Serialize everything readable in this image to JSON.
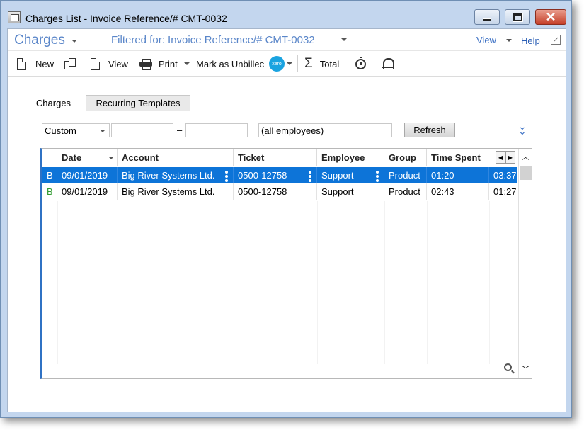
{
  "window": {
    "title": "Charges List - Invoice Reference/# CMT-0032",
    "close_glyph": "✕"
  },
  "header": {
    "module_title": "Charges",
    "filter_text": "Filtered for: Invoice Reference/# CMT-0032",
    "view_label": "View",
    "help_label": "Help"
  },
  "toolbar": {
    "new_label": "New",
    "view_label": "View",
    "print_label": "Print",
    "mark_unbilled_label": "Mark as Unbillec",
    "xero_label": "xero",
    "total_label": "Total"
  },
  "tabs": [
    {
      "label": "Charges",
      "active": true
    },
    {
      "label": "Recurring Templates",
      "active": false
    }
  ],
  "filters": {
    "range_value": "Custom",
    "date_from": "",
    "date_separator": "–",
    "date_to": "",
    "employee_value": "(all employees)",
    "refresh_label": "Refresh"
  },
  "grid": {
    "columns": [
      "Date",
      "Account",
      "Ticket",
      "Employee",
      "Group",
      "Time Spent"
    ],
    "rows": [
      {
        "flag": "B",
        "date": "09/01/2019",
        "account": "Big River Systems Ltd.",
        "ticket": "0500-12758",
        "employee": "Support",
        "group": "Product",
        "time_spent": "01:20",
        "extra": "03:37",
        "selected": true
      },
      {
        "flag": "B",
        "date": "09/01/2019",
        "account": "Big River Systems Ltd.",
        "ticket": "0500-12758",
        "employee": "Support",
        "group": "Product",
        "time_spent": "02:43",
        "extra": "01:27",
        "selected": false
      }
    ]
  },
  "colors": {
    "selection": "#0d74d8",
    "accent_blue": "#5a86c9",
    "flag_green": "#2e9a2e",
    "window_frame": "#c3d6ee"
  },
  "icons": [
    "app-icon",
    "minimize-icon",
    "maximize-icon",
    "close-icon",
    "new-document-icon",
    "copy-icon",
    "view-document-icon",
    "printer-icon",
    "xero-icon",
    "sigma-icon",
    "timer-icon",
    "bell-icon",
    "popout-icon",
    "expand-chevrons-icon",
    "search-icon"
  ]
}
